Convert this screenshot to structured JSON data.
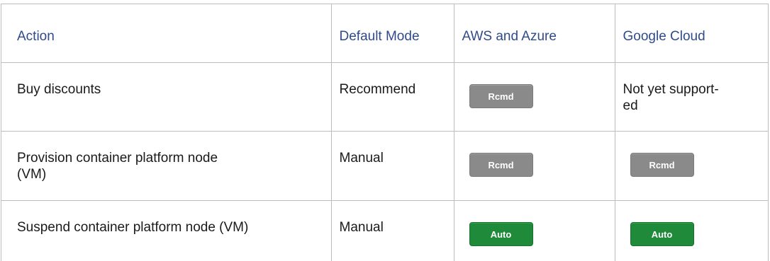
{
  "headers": {
    "action": "Action",
    "default_mode": "Default Mode",
    "aws_azure": "AWS and Azure",
    "google_cloud": "Google Cloud"
  },
  "rows": [
    {
      "action": "Buy discounts",
      "default_mode": "Recommend",
      "aws_azure_badge": "Rcmd",
      "google_cloud_text_line1": "Not yet support-",
      "google_cloud_text_line2": "ed"
    },
    {
      "action_line1": "Provision container platform node",
      "action_line2": "(VM)",
      "default_mode": "Manual",
      "aws_azure_badge": "Rcmd",
      "google_cloud_badge": "Rcmd"
    },
    {
      "action": "Suspend container platform node (VM)",
      "default_mode": "Manual",
      "aws_azure_badge": "Auto",
      "google_cloud_badge": "Auto"
    }
  ],
  "colors": {
    "header_text": "#2f4b8a",
    "rcmd_badge": "#8a8a8a",
    "auto_badge": "#1f8a3a",
    "border": "#bdbdbd"
  }
}
